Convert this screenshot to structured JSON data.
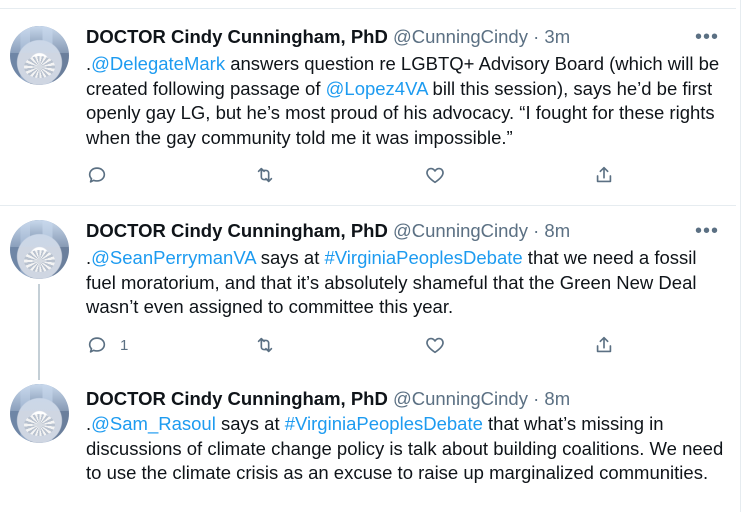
{
  "tweets": [
    {
      "name": "DOCTOR Cindy Cunningham, PhD",
      "handle": "@CunningCindy",
      "dot": "·",
      "time": "3m",
      "more": "•••",
      "text": {
        "p1": ".",
        "m1": "@DelegateMark",
        "p2": " answers question re LGBTQ+ Advisory Board (which will be created following passage of  ",
        "m2": "@Lopez4VA",
        "p3": " bill this session), says he’d be first openly gay LG, but he’s most proud of his advocacy. “I fought for these rights when the gay community told me it was impossible.”"
      },
      "reply_count": "",
      "icons": [
        "reply-icon",
        "retweet-icon",
        "like-icon",
        "share-icon"
      ]
    },
    {
      "name": "DOCTOR Cindy Cunningham, PhD",
      "handle": "@CunningCindy",
      "dot": "·",
      "time": "8m",
      "more": "•••",
      "text": {
        "p1": ".",
        "m1": "@SeanPerrymanVA",
        "p2": " says at ",
        "h1": "#VirginiaPeoplesDebate",
        "p3": " that we need a fossil fuel moratorium, and that it’s absolutely shameful that the Green New Deal wasn’t even assigned to  committee this year."
      },
      "reply_count": "1",
      "icons": [
        "reply-icon",
        "retweet-icon",
        "like-icon",
        "share-icon"
      ]
    },
    {
      "name": "DOCTOR Cindy Cunningham, PhD",
      "handle": "@CunningCindy",
      "dot": "·",
      "time": "8m",
      "text": {
        "p1": ".",
        "m1": "@Sam_Rasoul",
        "p2": " says at ",
        "h1": "#VirginiaPeoplesDebate",
        "p3": " that what’s missing in discussions of climate change policy is talk about building coalitions. We need to use the climate crisis as an excuse to raise up marginalized communities."
      }
    }
  ],
  "colors": {
    "link": "#1d9bf0",
    "secondary": "#5b7083",
    "divider": "#e6ecf0",
    "thread": "#c4cfd6"
  }
}
